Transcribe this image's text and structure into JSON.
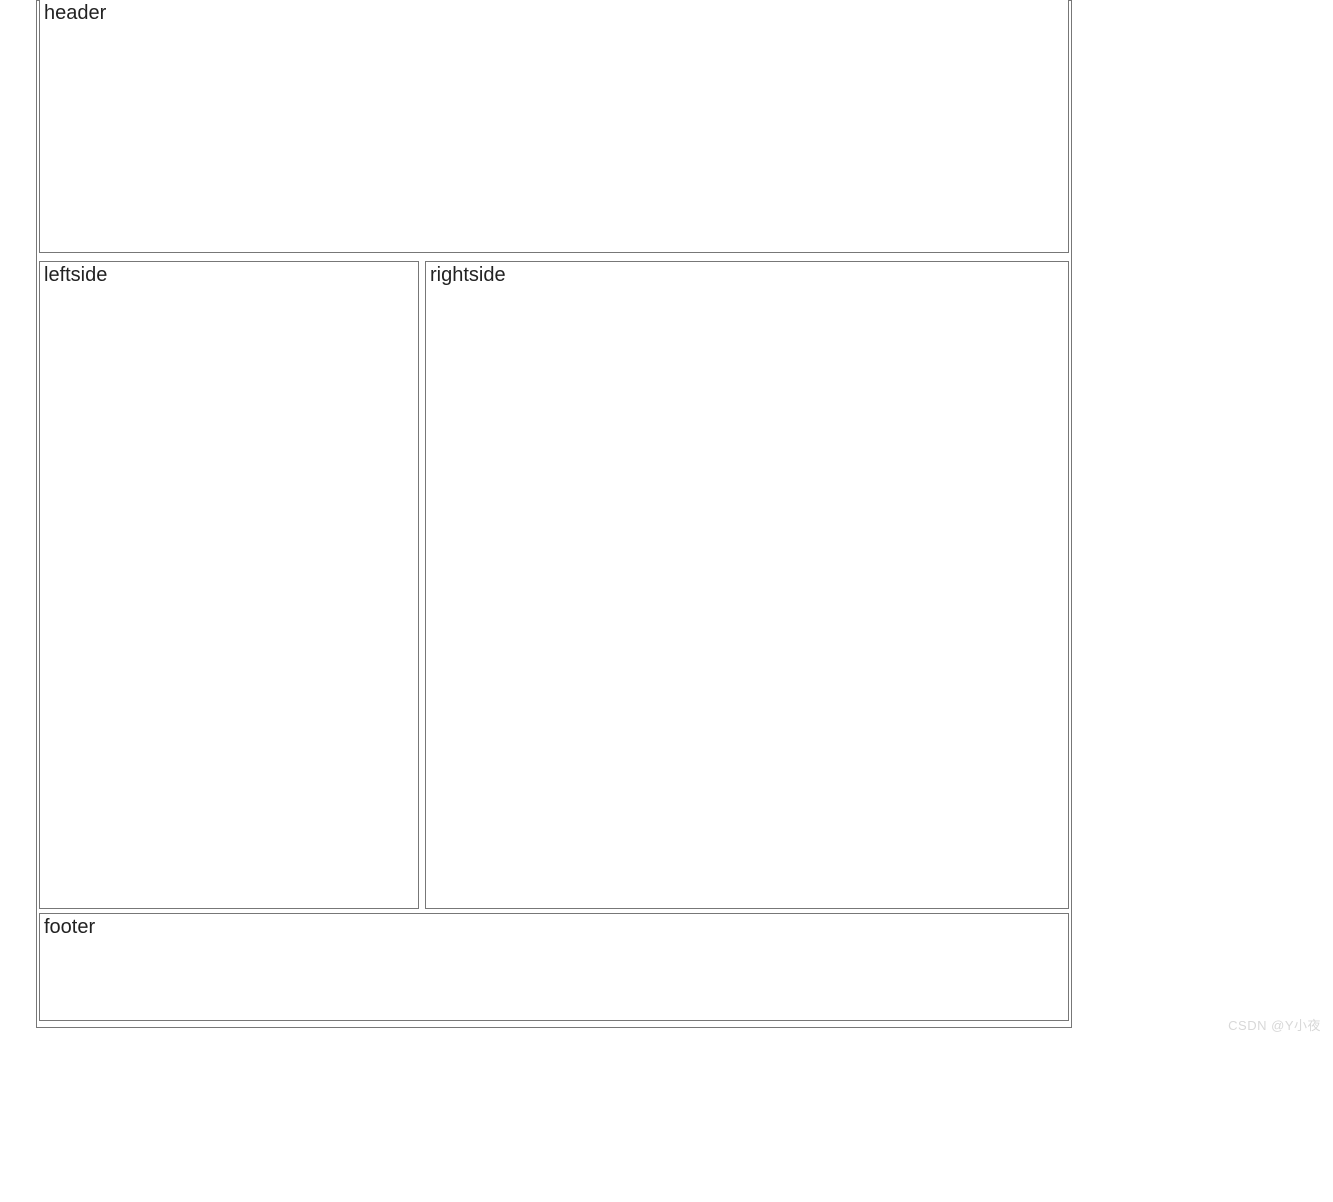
{
  "layout": {
    "header_label": "header",
    "leftside_label": "leftside",
    "rightside_label": "rightside",
    "footer_label": "footer"
  },
  "watermark": "CSDN @Y小夜"
}
